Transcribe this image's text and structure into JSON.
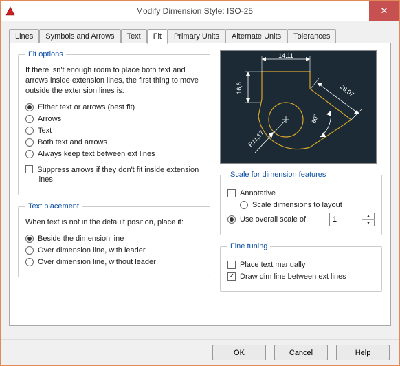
{
  "window": {
    "title": "Modify Dimension Style: ISO-25"
  },
  "tabs": {
    "lines": "Lines",
    "symbols": "Symbols and Arrows",
    "text": "Text",
    "fit": "Fit",
    "primary": "Primary Units",
    "alternate": "Alternate Units",
    "tolerances": "Tolerances"
  },
  "fit_options": {
    "legend": "Fit options",
    "description": "If there isn't enough room to place both text and arrows inside extension lines, the first thing to move outside the extension lines is:",
    "r1": "Either text or arrows (best fit)",
    "r2": "Arrows",
    "r3": "Text",
    "r4": "Both text and arrows",
    "r5": "Always keep text between ext lines",
    "suppress": "Suppress arrows if they don't fit inside extension lines",
    "selected": "r1"
  },
  "text_placement": {
    "legend": "Text placement",
    "description": "When text is not in the default position, place it:",
    "r1": "Beside the dimension line",
    "r2": "Over dimension line, with leader",
    "r3": "Over dimension line, without leader",
    "selected": "r1"
  },
  "preview": {
    "dim_top": "14,11",
    "dim_left": "16,6",
    "dim_diag": "28,07",
    "dim_angle": "60°",
    "dim_radius": "R11,17"
  },
  "scale": {
    "legend": "Scale for dimension features",
    "annotative": "Annotative",
    "to_layout": "Scale dimensions to layout",
    "overall": "Use overall scale of:",
    "selected": "overall",
    "value": "1"
  },
  "fine_tuning": {
    "legend": "Fine tuning",
    "manual": "Place text manually",
    "draw_dim": "Draw dim line between ext lines",
    "manual_checked": false,
    "draw_dim_checked": true
  },
  "buttons": {
    "ok": "OK",
    "cancel": "Cancel",
    "help": "Help"
  }
}
